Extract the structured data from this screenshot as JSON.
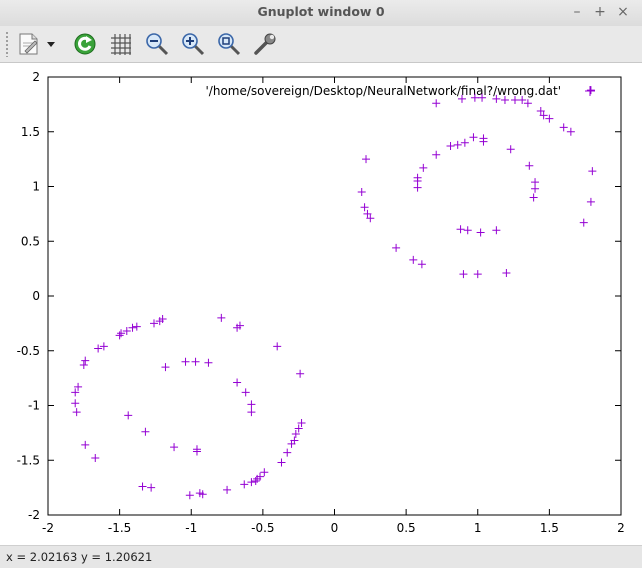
{
  "window": {
    "title": "Gnuplot window 0",
    "controls": {
      "minimize": "–",
      "maximize": "+",
      "close": "×"
    }
  },
  "toolbar": {
    "buttons": [
      {
        "name": "export-icon"
      },
      {
        "name": "dropdown-arrow-icon"
      },
      {
        "name": "replot-icon"
      },
      {
        "name": "grid-icon"
      },
      {
        "name": "zoom-out-icon"
      },
      {
        "name": "zoom-in-icon"
      },
      {
        "name": "zoom-fit-icon"
      },
      {
        "name": "settings-wrench-icon"
      }
    ]
  },
  "status": {
    "text": "x = 2.02163 y = 1.20621"
  },
  "colors": {
    "points": "#9400d3",
    "axis": "#000000"
  },
  "chart_data": {
    "type": "scatter",
    "xlim": [
      -2,
      2
    ],
    "ylim": [
      -2,
      2
    ],
    "xticks": [
      "-2",
      "-1.5",
      "-1",
      "-0.5",
      "0",
      "0.5",
      "1",
      "1.5",
      "2"
    ],
    "yticks": [
      "2",
      "1.5",
      "1",
      "0.5",
      "0",
      "-0.5",
      "-1",
      "-1.5",
      "-2"
    ],
    "grid": false,
    "legend_position": "top-right",
    "series": [
      {
        "name": "'/home/sovereign/Desktop/NeuralNetwork/final?/wrong.dat'",
        "marker": "+",
        "points": [
          [
            1.79,
            1.88
          ],
          [
            0.71,
            1.76
          ],
          [
            0.89,
            1.8
          ],
          [
            0.98,
            1.81
          ],
          [
            1.03,
            1.81
          ],
          [
            1.13,
            1.8
          ],
          [
            1.19,
            1.79
          ],
          [
            1.26,
            1.79
          ],
          [
            1.31,
            1.79
          ],
          [
            1.35,
            1.76
          ],
          [
            1.44,
            1.69
          ],
          [
            1.46,
            1.65
          ],
          [
            1.5,
            1.62
          ],
          [
            1.6,
            1.54
          ],
          [
            1.65,
            1.5
          ],
          [
            0.97,
            1.45
          ],
          [
            1.04,
            1.44
          ],
          [
            1.04,
            1.41
          ],
          [
            0.91,
            1.4
          ],
          [
            0.86,
            1.38
          ],
          [
            0.81,
            1.37
          ],
          [
            1.23,
            1.34
          ],
          [
            0.71,
            1.29
          ],
          [
            0.22,
            1.25
          ],
          [
            1.36,
            1.19
          ],
          [
            0.62,
            1.17
          ],
          [
            1.8,
            1.14
          ],
          [
            0.58,
            1.08
          ],
          [
            0.58,
            1.05
          ],
          [
            1.4,
            1.04
          ],
          [
            1.4,
            0.98
          ],
          [
            0.58,
            0.99
          ],
          [
            0.19,
            0.95
          ],
          [
            1.39,
            0.9
          ],
          [
            1.79,
            0.86
          ],
          [
            0.21,
            0.81
          ],
          [
            0.23,
            0.75
          ],
          [
            0.25,
            0.71
          ],
          [
            1.74,
            0.67
          ],
          [
            0.88,
            0.61
          ],
          [
            0.93,
            0.6
          ],
          [
            1.02,
            0.58
          ],
          [
            1.13,
            0.6
          ],
          [
            0.43,
            0.44
          ],
          [
            0.55,
            0.33
          ],
          [
            0.61,
            0.29
          ],
          [
            0.9,
            0.2
          ],
          [
            1.0,
            0.2
          ],
          [
            1.2,
            0.21
          ],
          [
            -0.79,
            -0.2
          ],
          [
            -1.2,
            -0.21
          ],
          [
            -1.22,
            -0.23
          ],
          [
            -1.26,
            -0.25
          ],
          [
            -0.66,
            -0.27
          ],
          [
            -1.38,
            -0.28
          ],
          [
            -1.41,
            -0.29
          ],
          [
            -0.68,
            -0.29
          ],
          [
            -1.45,
            -0.32
          ],
          [
            -1.49,
            -0.34
          ],
          [
            -1.5,
            -0.36
          ],
          [
            -1.61,
            -0.46
          ],
          [
            -1.65,
            -0.48
          ],
          [
            -0.4,
            -0.46
          ],
          [
            -1.04,
            -0.6
          ],
          [
            -0.97,
            -0.6
          ],
          [
            -0.88,
            -0.61
          ],
          [
            -1.74,
            -0.59
          ],
          [
            -1.75,
            -0.63
          ],
          [
            -1.18,
            -0.65
          ],
          [
            -0.24,
            -0.71
          ],
          [
            -0.68,
            -0.79
          ],
          [
            -1.79,
            -0.83
          ],
          [
            -1.81,
            -0.88
          ],
          [
            -0.62,
            -0.88
          ],
          [
            -1.81,
            -0.98
          ],
          [
            -0.58,
            -0.99
          ],
          [
            -1.8,
            -1.06
          ],
          [
            -0.58,
            -1.06
          ],
          [
            -1.44,
            -1.09
          ],
          [
            -0.23,
            -1.16
          ],
          [
            -0.25,
            -1.21
          ],
          [
            -0.27,
            -1.26
          ],
          [
            -1.32,
            -1.24
          ],
          [
            -0.28,
            -1.32
          ],
          [
            -0.3,
            -1.35
          ],
          [
            -1.74,
            -1.36
          ],
          [
            -1.12,
            -1.38
          ],
          [
            -0.96,
            -1.4
          ],
          [
            -0.96,
            -1.42
          ],
          [
            -0.33,
            -1.43
          ],
          [
            -1.67,
            -1.48
          ],
          [
            -0.37,
            -1.52
          ],
          [
            -0.49,
            -1.61
          ],
          [
            -0.52,
            -1.65
          ],
          [
            -0.54,
            -1.67
          ],
          [
            -0.55,
            -1.69
          ],
          [
            -0.58,
            -1.7
          ],
          [
            -0.63,
            -1.72
          ],
          [
            -1.34,
            -1.74
          ],
          [
            -1.28,
            -1.75
          ],
          [
            -0.75,
            -1.77
          ],
          [
            -0.94,
            -1.8
          ],
          [
            -0.92,
            -1.81
          ],
          [
            -1.01,
            -1.82
          ]
        ]
      }
    ]
  }
}
